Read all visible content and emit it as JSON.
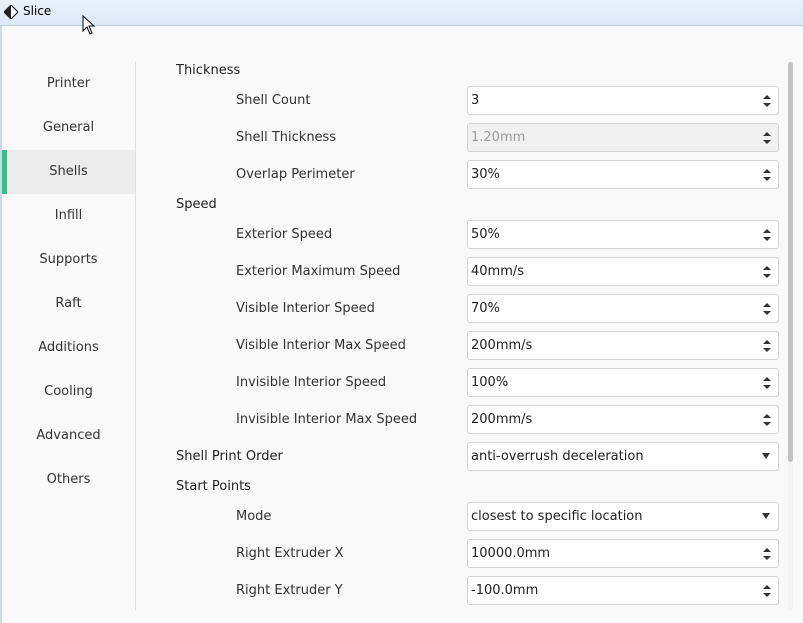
{
  "window": {
    "title": "Slice"
  },
  "sidebar": {
    "items": [
      {
        "label": "Printer"
      },
      {
        "label": "General"
      },
      {
        "label": "Shells",
        "active": true
      },
      {
        "label": "Infill"
      },
      {
        "label": "Supports"
      },
      {
        "label": "Raft"
      },
      {
        "label": "Additions"
      },
      {
        "label": "Cooling"
      },
      {
        "label": "Advanced"
      },
      {
        "label": "Others"
      }
    ]
  },
  "sections": {
    "thickness": "Thickness",
    "speed": "Speed",
    "shell_print_order": "Shell Print Order",
    "start_points": "Start Points"
  },
  "fields": {
    "shell_count": {
      "label": "Shell Count",
      "value": "3"
    },
    "shell_thickness": {
      "label": "Shell Thickness",
      "value": "1.20mm",
      "disabled": true
    },
    "overlap_perimeter": {
      "label": "Overlap Perimeter",
      "value": "30%"
    },
    "exterior_speed": {
      "label": "Exterior Speed",
      "value": "50%"
    },
    "exterior_max_speed": {
      "label": "Exterior Maximum Speed",
      "value": "40mm/s"
    },
    "visible_interior_speed": {
      "label": "Visible Interior Speed",
      "value": "70%"
    },
    "visible_interior_max_speed": {
      "label": "Visible Interior Max Speed",
      "value": "200mm/s"
    },
    "invisible_interior_speed": {
      "label": "Invisible Interior Speed",
      "value": "100%"
    },
    "invisible_interior_max_speed": {
      "label": "Invisible Interior Max Speed",
      "value": "200mm/s"
    },
    "shell_print_order": {
      "value": "anti-overrush deceleration"
    },
    "mode": {
      "label": "Mode",
      "value": "closest to specific location"
    },
    "right_extruder_x": {
      "label": "Right Extruder X",
      "value": "10000.0mm"
    },
    "right_extruder_y": {
      "label": "Right Extruder Y",
      "value": "-100.0mm"
    }
  },
  "colors": {
    "accent": "#2bc48a"
  }
}
